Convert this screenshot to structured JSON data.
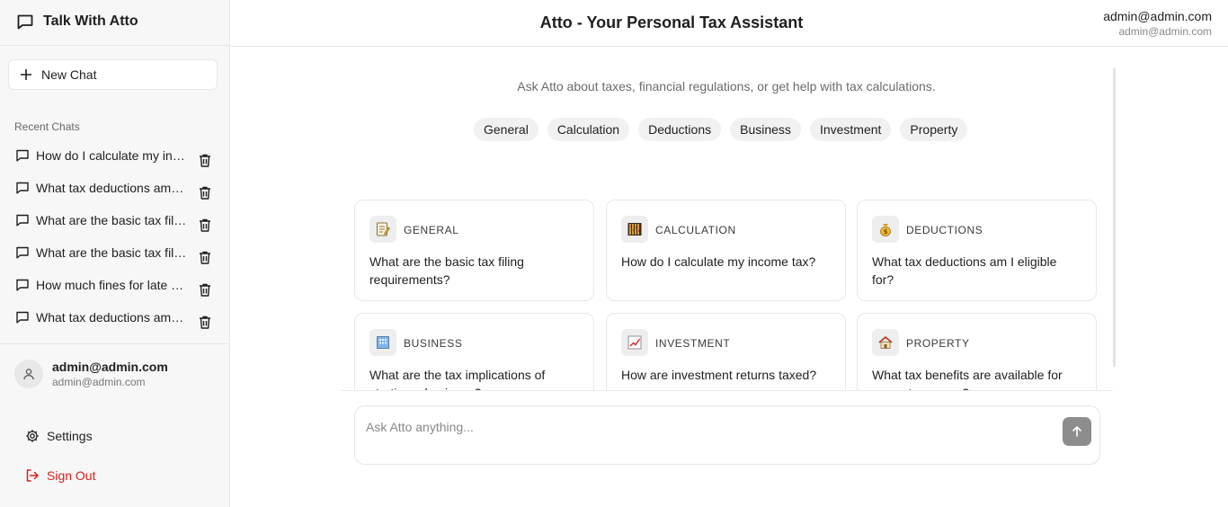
{
  "app": {
    "name": "Talk With Atto"
  },
  "sidebar": {
    "new_chat_label": "New Chat",
    "recent_label": "Recent Chats",
    "chats": [
      "How do I calculate my income tax?",
      "What tax deductions am I eligible for?",
      "What are the basic tax filing requirements?",
      "What are the basic tax filing requirements?",
      "How much fines for late returns?",
      "What tax deductions am I eligible for?"
    ],
    "user": {
      "name": "admin@admin.com",
      "email": "admin@admin.com"
    },
    "settings_label": "Settings",
    "signout_label": "Sign Out"
  },
  "header": {
    "title": "Atto - Your Personal Tax Assistant",
    "user_name": "admin@admin.com",
    "user_email": "admin@admin.com"
  },
  "main": {
    "subtitle": "Ask Atto about taxes, financial regulations, or get help with tax calculations.",
    "chips": [
      "General",
      "Calculation",
      "Deductions",
      "Business",
      "Investment",
      "Property"
    ],
    "cards": [
      {
        "category": "GENERAL",
        "icon": "memo-icon",
        "question": "What are the basic tax filing requirements?"
      },
      {
        "category": "CALCULATION",
        "icon": "abacus-icon",
        "question": "How do I calculate my income tax?"
      },
      {
        "category": "DEDUCTIONS",
        "icon": "money-bag-icon",
        "question": "What tax deductions am I eligible for?"
      },
      {
        "category": "BUSINESS",
        "icon": "office-building-icon",
        "question": "What are the tax implications of starting a business?"
      },
      {
        "category": "INVESTMENT",
        "icon": "chart-increasing-icon",
        "question": "How are investment returns taxed?"
      },
      {
        "category": "PROPERTY",
        "icon": "house-icon",
        "question": "What tax benefits are available for property owners?"
      }
    ]
  },
  "composer": {
    "placeholder": "Ask Atto anything..."
  },
  "colors": {
    "accent_danger": "#d72020",
    "send_button": "#8d8d8d"
  }
}
